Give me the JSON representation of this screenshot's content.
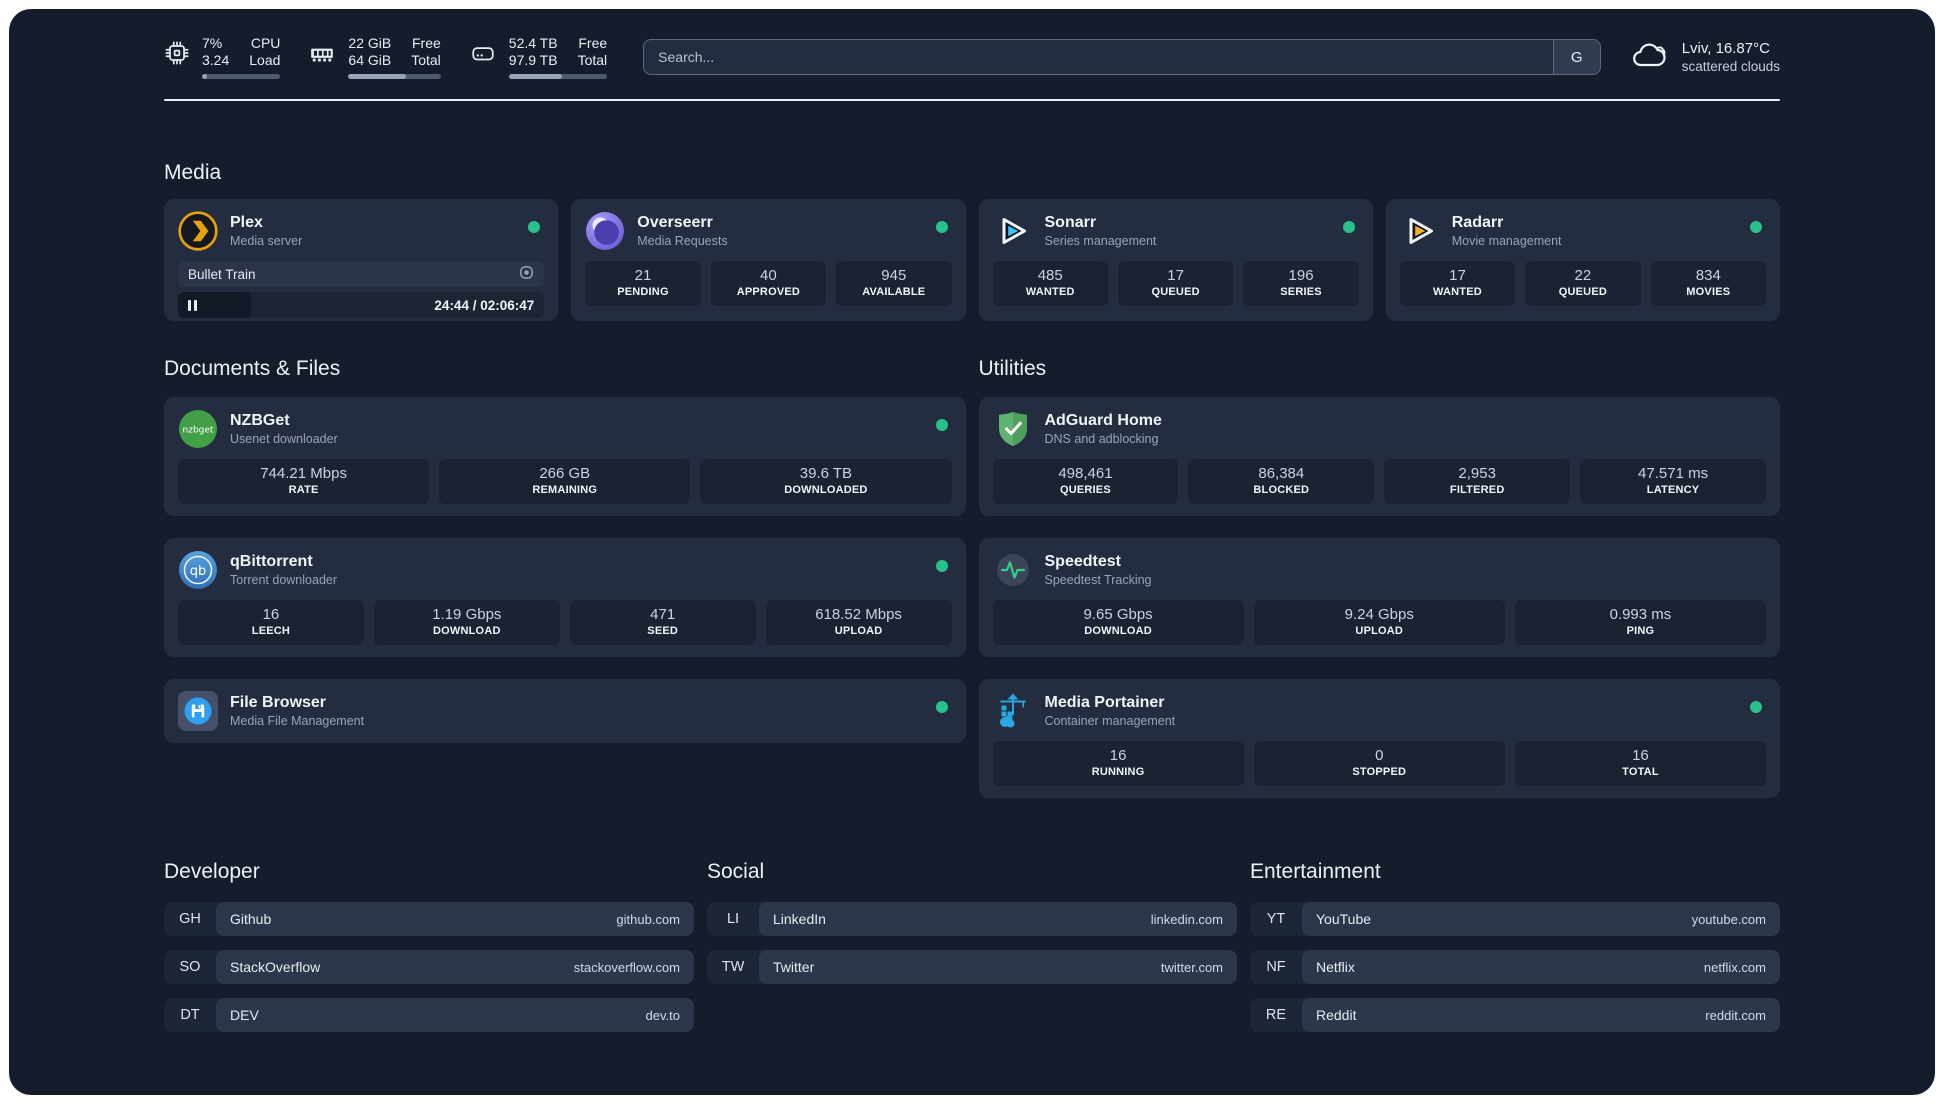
{
  "header": {
    "cpu": {
      "value1": "7%",
      "value2": "3.24",
      "label1": "CPU",
      "label2": "Load",
      "progress_percent": 7
    },
    "ram": {
      "value1": "22 GiB",
      "value2": "64 GiB",
      "label1": "Free",
      "label2": "Total",
      "progress_percent": 62
    },
    "disk": {
      "value1": "52.4 TB",
      "value2": "97.9 TB",
      "label1": "Free",
      "label2": "Total",
      "progress_percent": 54
    },
    "search": {
      "placeholder": "Search...",
      "engine_button": "G"
    },
    "weather": {
      "location": "Lviv, 16.87°C",
      "condition": "scattered clouds"
    }
  },
  "media": {
    "title": "Media",
    "plex": {
      "name": "Plex",
      "subtitle": "Media server",
      "now_playing": {
        "title": "Bullet Train",
        "time": "24:44 / 02:06:47",
        "progress_percent": 20
      }
    },
    "overseerr": {
      "name": "Overseerr",
      "subtitle": "Media Requests",
      "stats": [
        {
          "value": "21",
          "label": "PENDING"
        },
        {
          "value": "40",
          "label": "APPROVED"
        },
        {
          "value": "945",
          "label": "AVAILABLE"
        }
      ]
    },
    "sonarr": {
      "name": "Sonarr",
      "subtitle": "Series management",
      "stats": [
        {
          "value": "485",
          "label": "WANTED"
        },
        {
          "value": "17",
          "label": "QUEUED"
        },
        {
          "value": "196",
          "label": "SERIES"
        }
      ]
    },
    "radarr": {
      "name": "Radarr",
      "subtitle": "Movie management",
      "stats": [
        {
          "value": "17",
          "label": "WANTED"
        },
        {
          "value": "22",
          "label": "QUEUED"
        },
        {
          "value": "834",
          "label": "MOVIES"
        }
      ]
    }
  },
  "documents": {
    "title": "Documents & Files",
    "nzbget": {
      "name": "NZBGet",
      "subtitle": "Usenet downloader",
      "stats": [
        {
          "value": "744.21 Mbps",
          "label": "RATE"
        },
        {
          "value": "266 GB",
          "label": "REMAINING"
        },
        {
          "value": "39.6 TB",
          "label": "DOWNLOADED"
        }
      ]
    },
    "qbittorrent": {
      "name": "qBittorrent",
      "subtitle": "Torrent downloader",
      "stats": [
        {
          "value": "16",
          "label": "LEECH"
        },
        {
          "value": "1.19 Gbps",
          "label": "DOWNLOAD"
        },
        {
          "value": "471",
          "label": "SEED"
        },
        {
          "value": "618.52 Mbps",
          "label": "UPLOAD"
        }
      ]
    },
    "filebrowser": {
      "name": "File Browser",
      "subtitle": "Media File Management"
    }
  },
  "utilities": {
    "title": "Utilities",
    "adguard": {
      "name": "AdGuard Home",
      "subtitle": "DNS and adblocking",
      "stats": [
        {
          "value": "498,461",
          "label": "QUERIES"
        },
        {
          "value": "86,384",
          "label": "BLOCKED"
        },
        {
          "value": "2,953",
          "label": "FILTERED"
        },
        {
          "value": "47.571 ms",
          "label": "LATENCY"
        }
      ]
    },
    "speedtest": {
      "name": "Speedtest",
      "subtitle": "Speedtest Tracking",
      "stats": [
        {
          "value": "9.65 Gbps",
          "label": "DOWNLOAD"
        },
        {
          "value": "9.24 Gbps",
          "label": "UPLOAD"
        },
        {
          "value": "0.993 ms",
          "label": "PING"
        }
      ]
    },
    "portainer": {
      "name": "Media Portainer",
      "subtitle": "Container management",
      "stats": [
        {
          "value": "16",
          "label": "RUNNING"
        },
        {
          "value": "0",
          "label": "STOPPED"
        },
        {
          "value": "16",
          "label": "TOTAL"
        }
      ]
    }
  },
  "links": {
    "developer": {
      "title": "Developer",
      "items": [
        {
          "prefix": "GH",
          "name": "Github",
          "url": "github.com"
        },
        {
          "prefix": "SO",
          "name": "StackOverflow",
          "url": "stackoverflow.com"
        },
        {
          "prefix": "DT",
          "name": "DEV",
          "url": "dev.to"
        }
      ]
    },
    "social": {
      "title": "Social",
      "items": [
        {
          "prefix": "LI",
          "name": "LinkedIn",
          "url": "linkedin.com"
        },
        {
          "prefix": "TW",
          "name": "Twitter",
          "url": "twitter.com"
        }
      ]
    },
    "entertainment": {
      "title": "Entertainment",
      "items": [
        {
          "prefix": "YT",
          "name": "YouTube",
          "url": "youtube.com"
        },
        {
          "prefix": "NF",
          "name": "Netflix",
          "url": "netflix.com"
        },
        {
          "prefix": "RE",
          "name": "Reddit",
          "url": "reddit.com"
        }
      ]
    }
  },
  "colors": {
    "status_green": "#27c289",
    "plex_amber": "#e8a30c",
    "sonarr_blue": "#38c6f4",
    "radarr_yellow": "#f5b01d",
    "nzbget_green": "#43a047",
    "qbittorrent_blue": "#3d87cc",
    "adguard_green": "#5fb370",
    "speedtest_green": "#2fd08c",
    "portainer_blue": "#2aa7de"
  }
}
